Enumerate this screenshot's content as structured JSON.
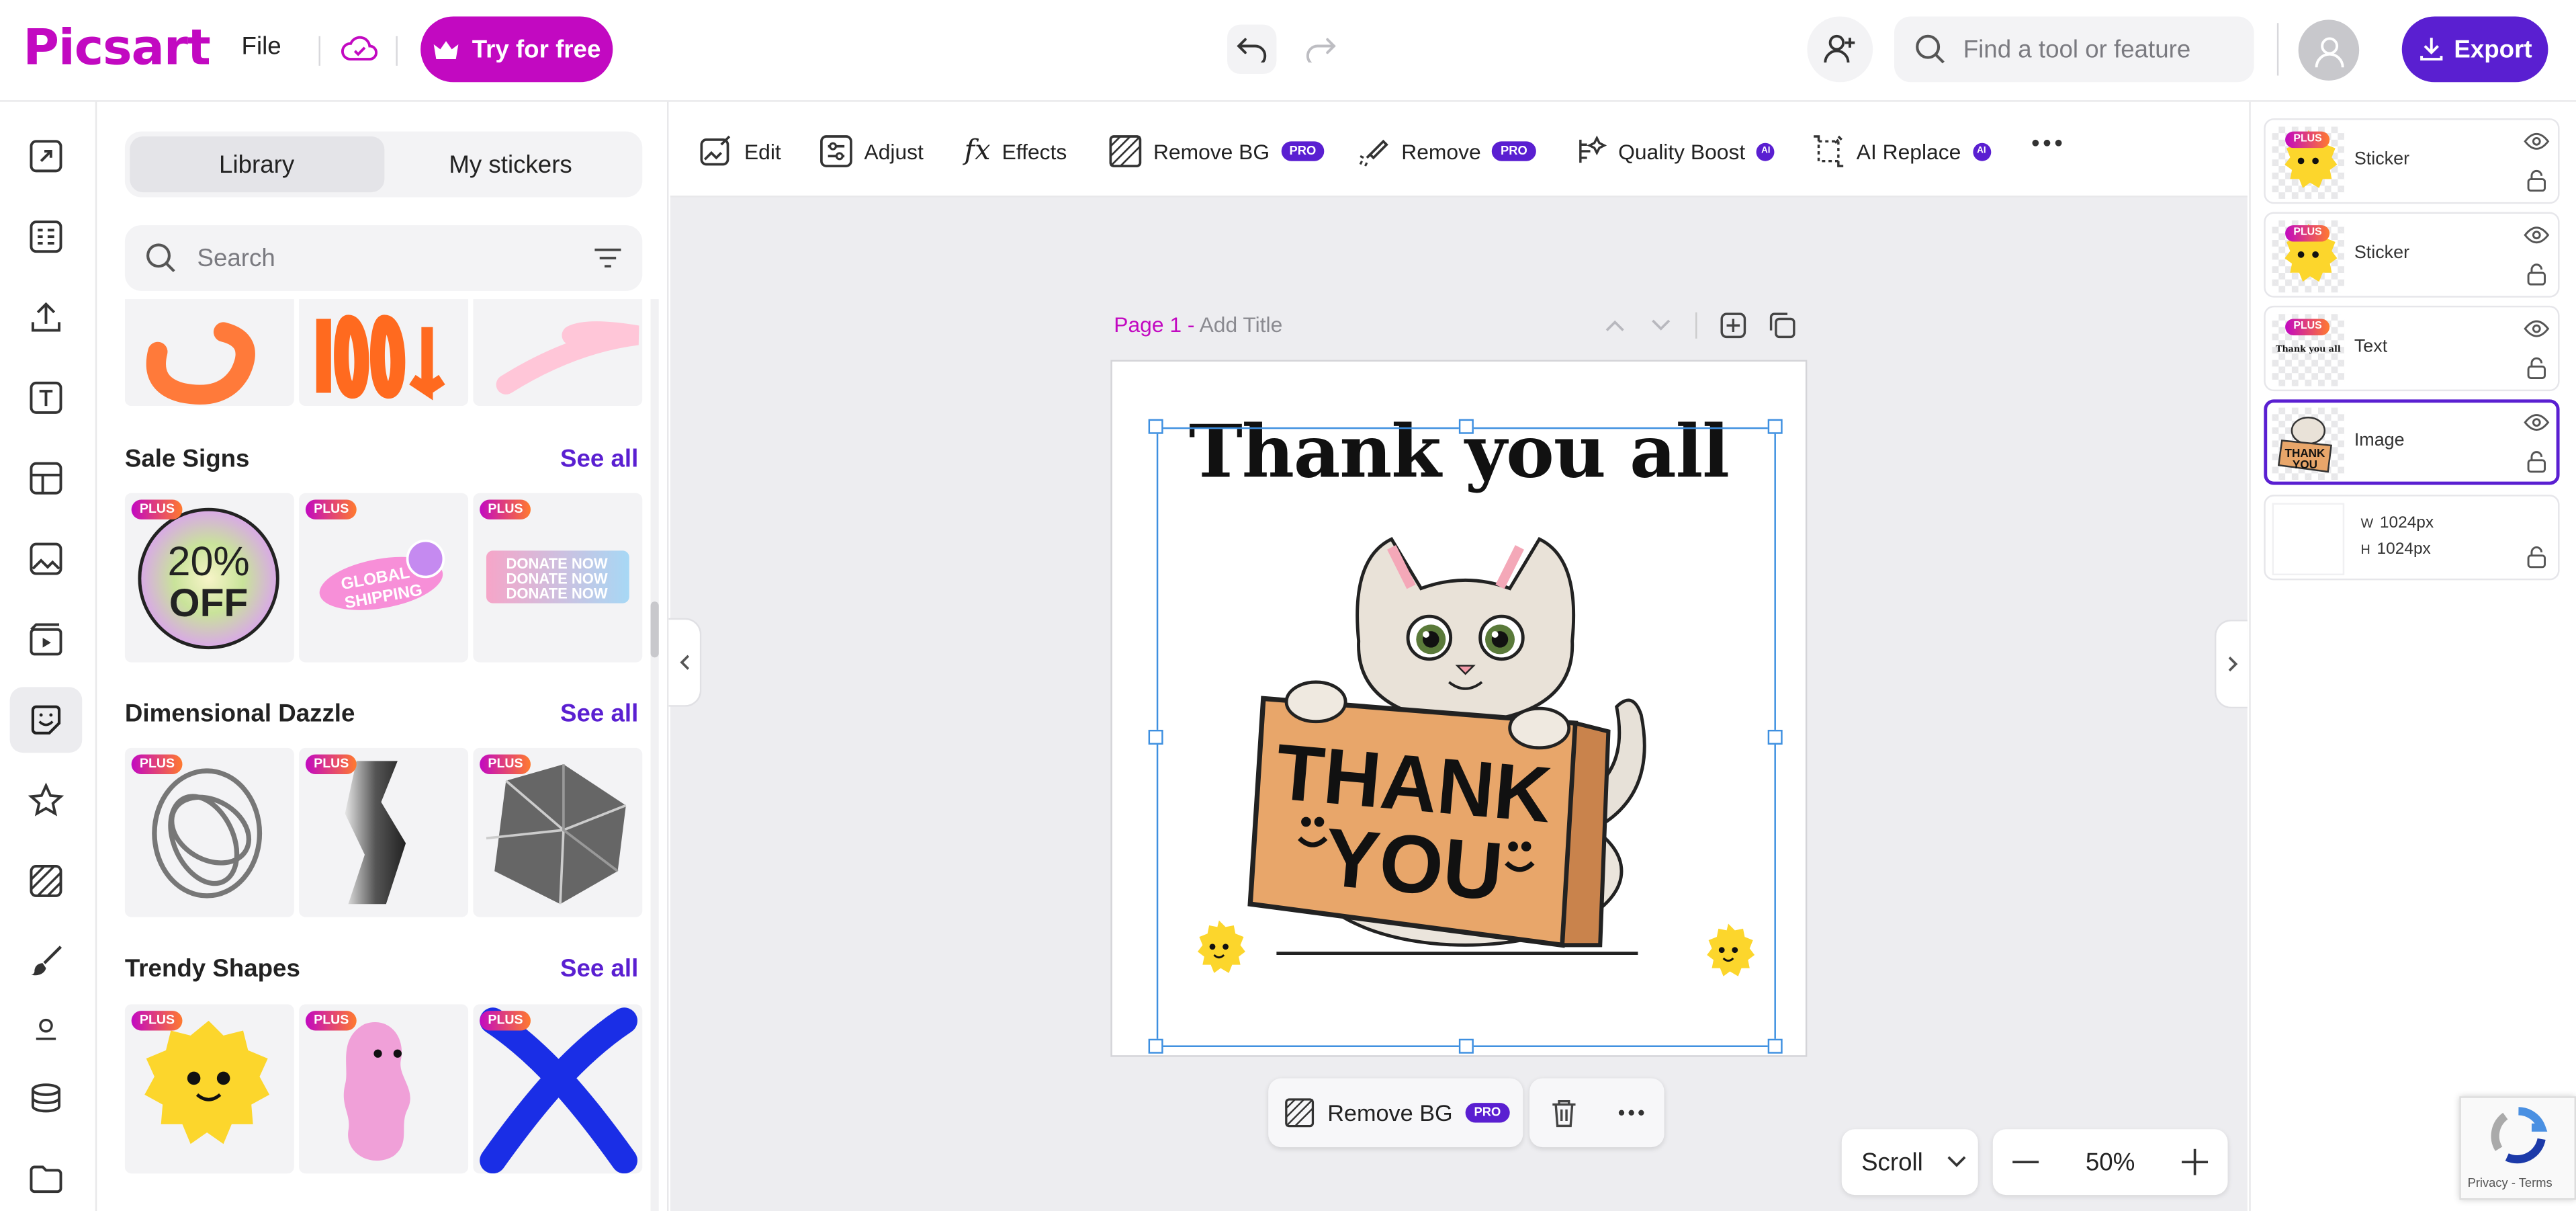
{
  "topbar": {
    "logo": "Picsart",
    "file_menu": "File",
    "try_label": "Try for free",
    "search_placeholder": "Find a tool or feature",
    "export_label": "Export"
  },
  "panel": {
    "tabs": [
      "Library",
      "My stickers"
    ],
    "active_tab": "Library",
    "search_placeholder": "Search",
    "plus_badge": "PLUS",
    "sections": [
      {
        "title": "Sale Signs",
        "see_all": "See all",
        "tiles": [
          "20% OFF",
          "GLOBAL SHIPPING",
          "DONATE NOW"
        ]
      },
      {
        "title": "Dimensional Dazzle",
        "see_all": "See all",
        "tiles": [
          "chrome knot",
          "zigzag",
          "crystal"
        ]
      },
      {
        "title": "Trendy Shapes",
        "see_all": "See all",
        "tiles": [
          "yellow flower",
          "pink blob",
          "blue x"
        ]
      }
    ]
  },
  "toolbar": {
    "edit": "Edit",
    "adjust": "Adjust",
    "effects": "Effects",
    "remove_bg": "Remove BG",
    "remove": "Remove",
    "quality_boost": "Quality Boost",
    "ai_replace": "AI Replace",
    "pro_badge": "PRO",
    "ai_badge": "AI"
  },
  "canvas": {
    "page_label": "Page 1 -",
    "page_title_placeholder": "Add Title",
    "headline": "Thank you all",
    "sign_line1": "THANK",
    "sign_line2": "YOU"
  },
  "context_bar": {
    "remove_bg": "Remove BG",
    "pro_badge": "PRO"
  },
  "bottom": {
    "scroll_mode": "Scroll",
    "zoom": "50%"
  },
  "layers": [
    {
      "name": "Sticker",
      "badge": "PLUS",
      "selected": false
    },
    {
      "name": "Sticker",
      "badge": "PLUS",
      "selected": false
    },
    {
      "name": "Text",
      "badge": "PLUS",
      "thumb_text": "Thank you all",
      "selected": false
    },
    {
      "name": "Image",
      "badge": "",
      "selected": true
    }
  ],
  "background_layer": {
    "w_label": "W",
    "w_value": "1024px",
    "h_label": "H",
    "h_value": "1024px"
  },
  "recaptcha": {
    "privacy": "Privacy",
    "sep": " - ",
    "terms": "Terms"
  },
  "colors": {
    "brand": "#c209c1",
    "accent": "#5a1fd1",
    "selection": "#3d8fe0"
  }
}
